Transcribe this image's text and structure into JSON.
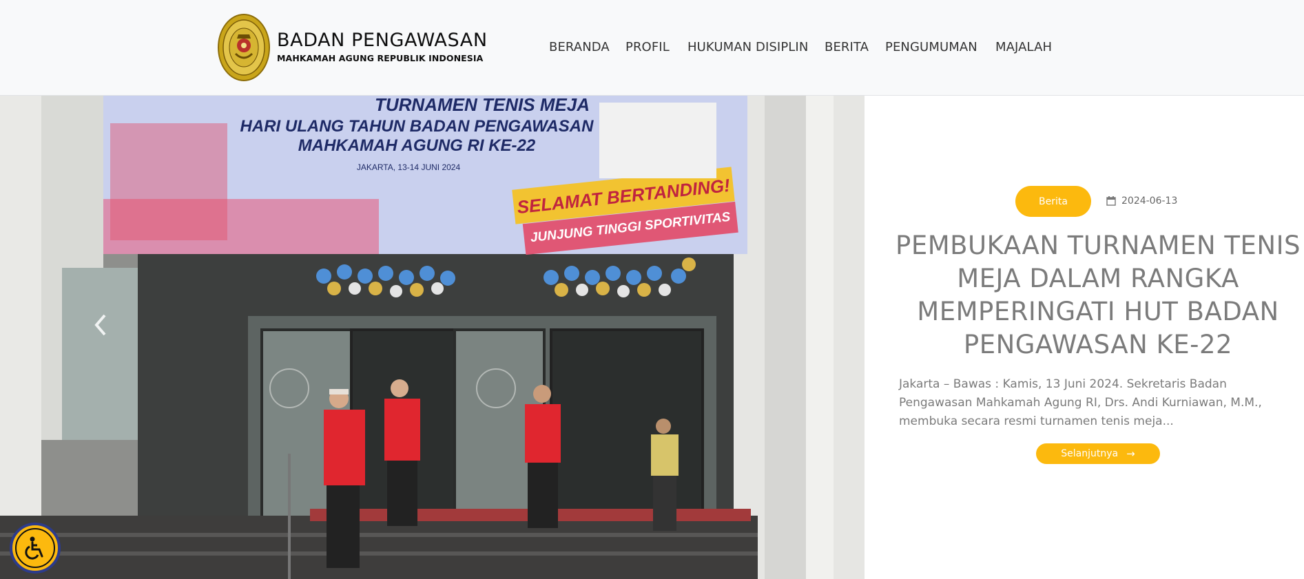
{
  "header": {
    "brand_title": "BADAN PENGAWASAN",
    "brand_subtitle": "MAHKAMAH AGUNG REPUBLIK INDONESIA",
    "logo_icon": "mahkamah-agung-emblem",
    "nav": [
      "BERANDA",
      "PROFIL",
      "HUKUMAN DISIPLIN",
      "BERITA",
      "PENGUMUMAN",
      "MAJALAH"
    ]
  },
  "hero": {
    "banner": {
      "line1": "TURNAMEN TENIS MEJA",
      "line2": "HARI ULANG TAHUN BADAN PENGAWASAN",
      "line3": "MAHKAMAH AGUNG RI KE-22",
      "date": "JAKARTA, 13-14 JUNI 2024",
      "slogan1": "SELAMAT BERTANDING!",
      "slogan2": "JUNJUNG TINGGI SPORTIVITAS"
    },
    "category_badge": "Berita",
    "date_icon": "calendar-icon",
    "date": "2024-06-13",
    "headline": "PEMBUKAAN TURNAMEN TENIS MEJA DALAM RANGKA MEMPERINGATI HUT BADAN PENGAWASAN KE-22",
    "excerpt": "Jakarta – Bawas : Kamis, 13 Juni 2024. Sekretaris Badan Pengawasan Mahkamah Agung RI, Drs.  Andi Kurniawan, M.M., membuka secara resmi turnamen tenis meja...",
    "read_more": "Selanjutnya",
    "read_more_icon": "arrow-right-icon",
    "prev_icon": "chevron-left-icon"
  },
  "accessibility": {
    "icon": "wheelchair-icon"
  },
  "colors": {
    "accent": "#fcb90e",
    "header_bg": "#f8f9fa",
    "nav_text": "#333333",
    "headline_text": "#7b7b7b",
    "a11y_border": "#2c3b8c"
  }
}
